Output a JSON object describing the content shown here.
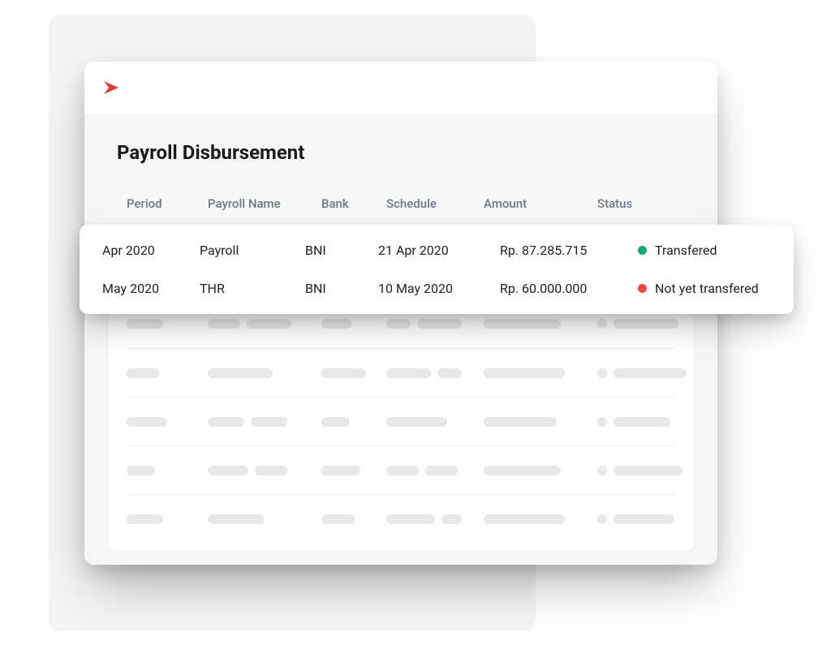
{
  "page": {
    "title": "Payroll Disbursement"
  },
  "table": {
    "columns": [
      "Period",
      "Payroll Name",
      "Bank",
      "Schedule",
      "Amount",
      "Status"
    ],
    "rows": [
      {
        "period": "Apr 2020",
        "payroll_name": "Payroll",
        "bank": "BNI",
        "schedule": "21 Apr 2020",
        "amount": "Rp. 87.285.715",
        "status_label": "Transfered",
        "status_color": "green"
      },
      {
        "period": "May 2020",
        "payroll_name": "THR",
        "bank": "BNI",
        "schedule": "10 May 2020",
        "amount": "Rp. 60.000.000",
        "status_label": "Not yet transfered",
        "status_color": "red"
      }
    ]
  },
  "colors": {
    "accent": "#e74c3c",
    "status_ok": "#17a673",
    "status_pending": "#e74c3c"
  }
}
